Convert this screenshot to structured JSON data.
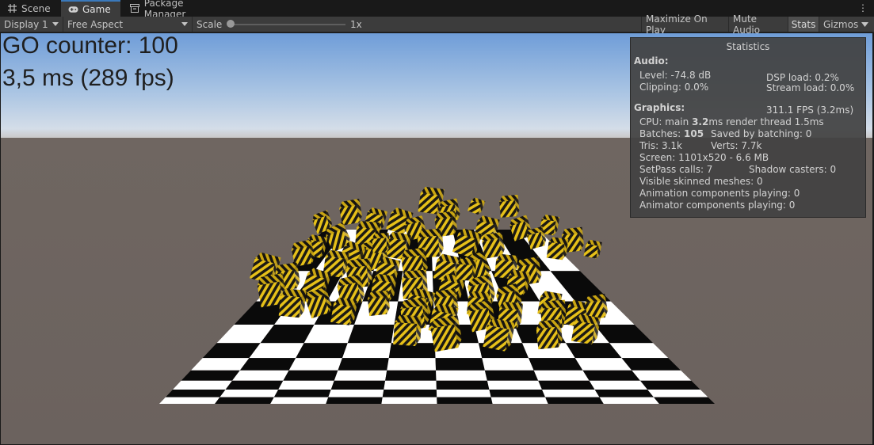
{
  "tabs": [
    {
      "label": "Scene",
      "icon": "grid-icon"
    },
    {
      "label": "Game",
      "icon": "gamepad-icon"
    },
    {
      "label": "Package Manager",
      "icon": "package-icon"
    }
  ],
  "toolbar": {
    "display": "Display 1",
    "aspect": "Free Aspect",
    "scale_label": "Scale",
    "scale_value": "1x",
    "scale_position": 0,
    "maximize": "Maximize On Play",
    "mute": "Mute Audio",
    "stats": "Stats",
    "gizmos": "Gizmos"
  },
  "hud": {
    "counter": "GO counter: 100",
    "timing": "3,5 ms (289 fps)"
  },
  "stats": {
    "title": "Statistics",
    "audio_header": "Audio:",
    "level": "Level: -74.8 dB",
    "dsp": "DSP load: 0.2%",
    "clipping": "Clipping: 0.0%",
    "stream": "Stream load: 0.0%",
    "graphics_header": "Graphics:",
    "fps": "311.1 FPS (3.2ms)",
    "cpu_prefix": "CPU: main ",
    "cpu_main": "3.2",
    "cpu_suffix": "ms  render thread 1.5ms",
    "batches_prefix": "Batches: ",
    "batches": "105",
    "saved": "Saved by batching: 0",
    "tris": "Tris: 3.1k",
    "verts": "Verts: 7.7k",
    "screen": "Screen: 1101x520 - 6.6 MB",
    "setpass": "SetPass calls: 7",
    "shadow": "Shadow casters: 0",
    "skinned": "Visible skinned meshes: 0",
    "animation": "Animation components playing: 0",
    "animator": "Animator components playing: 0"
  },
  "colors": {
    "accent": "#3a79bb",
    "ground": "#6d6460",
    "sky_top": "#6f9dd8",
    "cube_yellow": "#e8c21a",
    "cube_black": "#1a1a1a"
  }
}
